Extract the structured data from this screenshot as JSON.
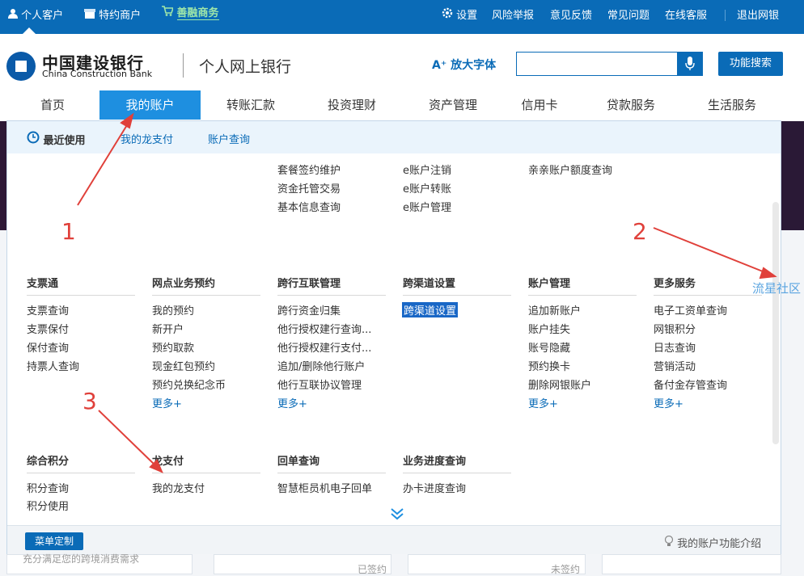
{
  "topbar": {
    "personal": "个人客户",
    "merchant": "特约商户",
    "business": "善融商务",
    "settings": "设置",
    "report": "风险举报",
    "feedback": "意见反馈",
    "faq": "常见问题",
    "service": "在线客服",
    "logout": "退出网银"
  },
  "header": {
    "logo_cn": "中国建设银行",
    "logo_en": "China Construction Bank",
    "site_title": "个人网上银行",
    "font_enlarge": "放大字体",
    "search_placeholder": "",
    "func_search": "功能搜索"
  },
  "nav": [
    {
      "label": "首页"
    },
    {
      "label": "我的账户"
    },
    {
      "label": "转账汇款"
    },
    {
      "label": "投资理财"
    },
    {
      "label": "资产管理"
    },
    {
      "label": "信用卡"
    },
    {
      "label": "贷款服务"
    },
    {
      "label": "生活服务"
    }
  ],
  "panel": {
    "tabs": [
      "最近使用",
      "我的龙支付",
      "账户查询"
    ],
    "top_links": {
      "col3": [
        "套餐签约维护",
        "资金托管交易",
        "基本信息查询"
      ],
      "col4": [
        "e账户注销",
        "e账户转账",
        "e账户管理"
      ],
      "col5": [
        "亲亲账户额度查询"
      ]
    },
    "groups": [
      {
        "title": "支票通",
        "items": [
          "支票查询",
          "支票保付",
          "保付查询",
          "持票人查询"
        ]
      },
      {
        "title": "网点业务预约",
        "items": [
          "我的预约",
          "新开户",
          "预约取款",
          "现金红包预约",
          "预约兑换纪念币"
        ],
        "more": "更多+"
      },
      {
        "title": "跨行互联管理",
        "items": [
          "跨行资金归集",
          "他行授权建行查询...",
          "他行授权建行支付...",
          "追加/删除他行账户",
          "他行互联协议管理"
        ],
        "more": "更多+"
      },
      {
        "title": "跨渠道设置",
        "items": [
          "跨渠道设置"
        ]
      },
      {
        "title": "账户管理",
        "items": [
          "追加新账户",
          "账户挂失",
          "账号隐藏",
          "预约换卡",
          "删除网银账户"
        ],
        "more": "更多+"
      },
      {
        "title": "更多服务",
        "items": [
          "电子工资单查询",
          "网银积分",
          "日志查询",
          "营销活动",
          "备付金存管查询"
        ],
        "more": "更多+"
      },
      {
        "title": "综合积分",
        "items": [
          "积分查询",
          "积分使用"
        ]
      },
      {
        "title": "龙支付",
        "items": [
          "我的龙支付"
        ]
      },
      {
        "title": "回单查询",
        "items": [
          "智慧柜员机电子回单"
        ]
      },
      {
        "title": "业务进度查询",
        "items": [
          "办卡进度查询"
        ]
      }
    ],
    "menu_custom": "菜单定制",
    "intro": "我的账户功能介绍"
  },
  "side_link": "流星社区",
  "bottom": {
    "promo": "充分满足您的跨境消费需求",
    "status1": "已签约",
    "status2": "未签约"
  },
  "annotations": [
    "1",
    "2",
    "3"
  ],
  "colors": {
    "brand_blue": "#0a6bb7",
    "active_nav": "#1e8fe0",
    "annotation_red": "#e0403a"
  }
}
